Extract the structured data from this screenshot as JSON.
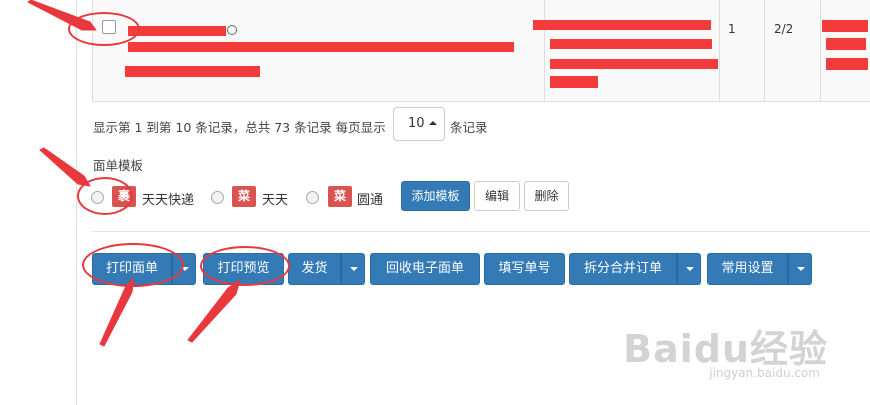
{
  "table": {
    "row": {
      "quantity": "1",
      "progress": "2/2"
    }
  },
  "pagination": {
    "info": "显示第 1 到第 10 条记录，总共 73 条记录 每页显示",
    "page_size": "10",
    "suffix": "条记录"
  },
  "template": {
    "label": "面单模板",
    "options": [
      {
        "badge": "裹",
        "name": "天天快递"
      },
      {
        "badge": "菜",
        "name": "天天"
      },
      {
        "badge": "菜",
        "name": "圆通"
      }
    ],
    "buttons": {
      "add": "添加模板",
      "edit": "编辑",
      "delete": "删除"
    }
  },
  "actions": {
    "print_waybill": "打印面单",
    "print_preview": "打印预览",
    "ship": "发货",
    "recycle_e_waybill": "回收电子面单",
    "fill_tracking": "填写单号",
    "split_merge": "拆分合并订单",
    "common_settings": "常用设置"
  },
  "watermark": {
    "brand": "Baidu经验",
    "url": "jingyan.baidu.com"
  },
  "colors": {
    "primary": "#337ab7",
    "badge": "#d9534f",
    "annotation": "#e8383d"
  }
}
